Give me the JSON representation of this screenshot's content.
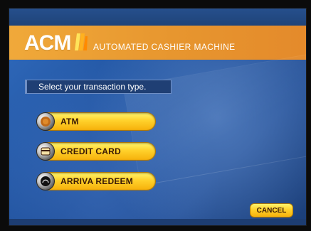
{
  "brand": {
    "logo_text": "ACM",
    "subtitle": "AUTOMATED CASHIER MACHINE"
  },
  "prompt": {
    "text": "Select your transaction type."
  },
  "options": [
    {
      "label": "ATM",
      "icon": "coin-icon"
    },
    {
      "label": "CREDIT CARD",
      "icon": "card-icon"
    },
    {
      "label": "ARRIVA REDEEM",
      "icon": "arriva-icon"
    }
  ],
  "buttons": {
    "cancel_label": "CANCEL"
  },
  "colors": {
    "accent": "#ffd12b",
    "banner": "#e7962f",
    "background": "#2c5ea8"
  }
}
